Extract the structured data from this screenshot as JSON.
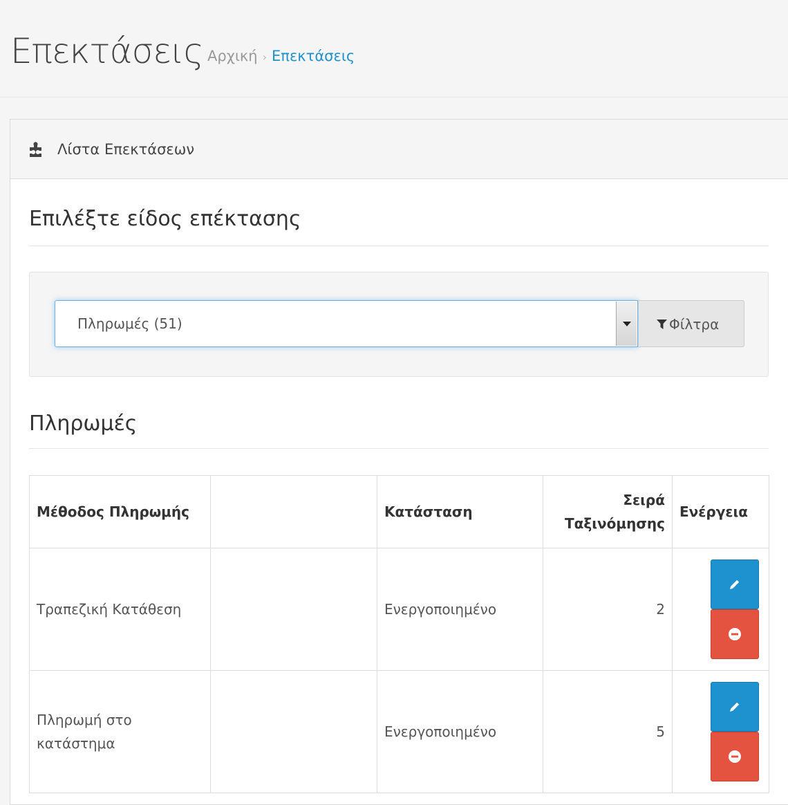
{
  "header": {
    "title": "Επεκτάσεις",
    "breadcrumb": {
      "home": "Αρχική",
      "separator": "›",
      "current": "Επεκτάσεις"
    }
  },
  "panel": {
    "icon": "puzzle-icon",
    "title": "Λίστα Επεκτάσεων",
    "choose_type_heading": "Επιλέξτε είδος επέκτασης",
    "filter": {
      "selected": "Πληρωμές (51)",
      "button_label": "Φίλτρα",
      "button_icon": "filter-icon"
    },
    "section_heading": "Πληρωμές",
    "table": {
      "columns": [
        "Μέθοδος Πληρωμής",
        "",
        "Κατάσταση",
        "Σειρά Ταξινόμησης",
        "Ενέργεια"
      ],
      "rows": [
        {
          "method": "Τραπεζική Κατάθεση",
          "extra": "",
          "status": "Ενεργοποιημένο",
          "sort_order": "2"
        },
        {
          "method": "Πληρωμή στο κατάστημα",
          "extra": "",
          "status": "Ενεργοποιημένο",
          "sort_order": "5"
        }
      ]
    }
  },
  "colors": {
    "accent": "#1e91cf",
    "danger": "#e4533f",
    "background": "#f5f5f5"
  }
}
